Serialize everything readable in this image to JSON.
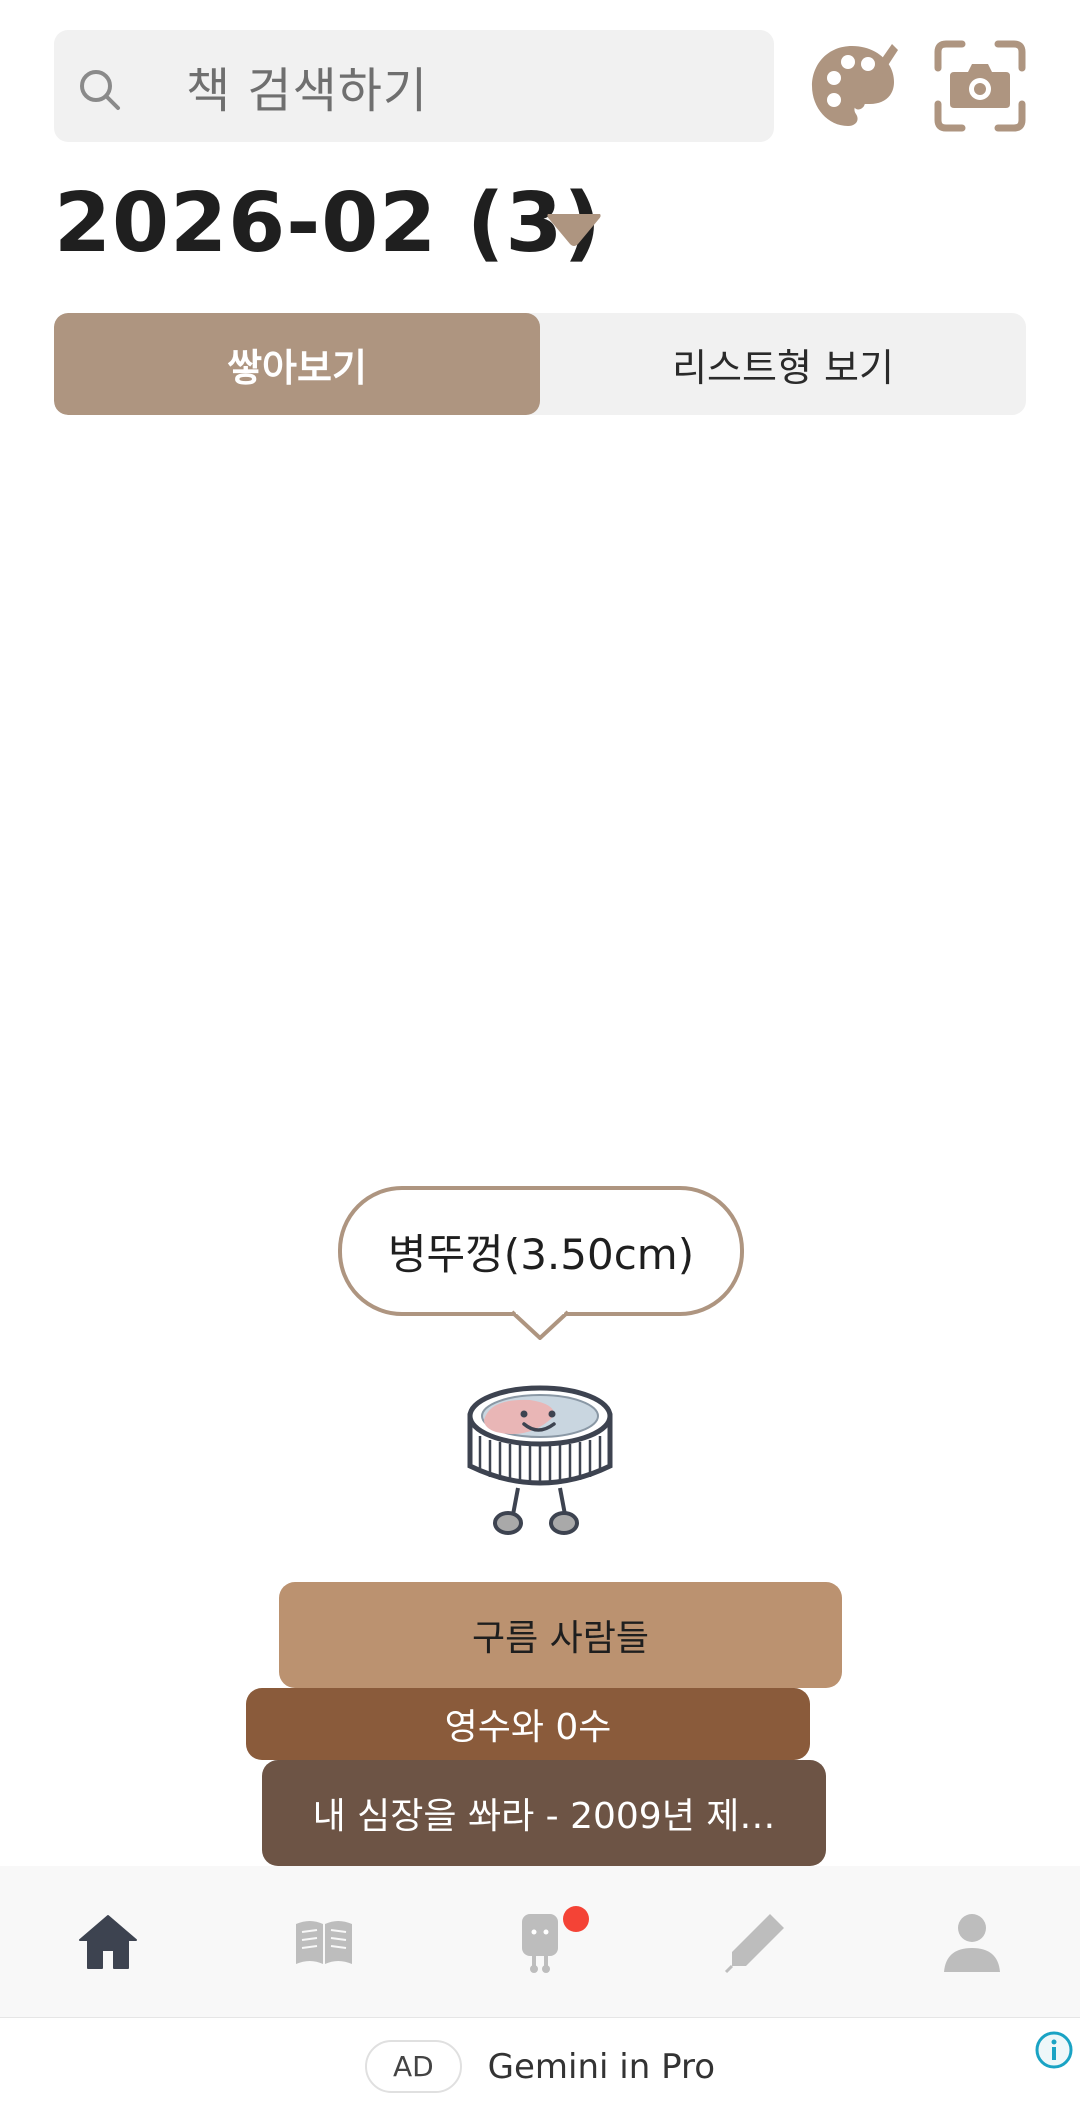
{
  "header": {
    "search_placeholder": "책 검색하기",
    "palette_icon": "palette-icon",
    "camera_icon": "camera-icon"
  },
  "month": {
    "title": "2026-02 (3)",
    "dropdown_icon": "caret-down-icon"
  },
  "view_toggle": {
    "tabs": [
      {
        "label": "쌓아보기",
        "active": true
      },
      {
        "label": "리스트형 보기",
        "active": false
      }
    ]
  },
  "bubble": {
    "text": "병뚜껑(3.50cm)"
  },
  "books": [
    {
      "title": "구름 사람들",
      "color": "#bb9270"
    },
    {
      "title": "영수와 0수",
      "color": "#8a5b3b"
    },
    {
      "title": "내 심장을 쏴라 - 2009년 제…",
      "color": "#6d5445"
    }
  ],
  "bottom_nav": {
    "items": [
      {
        "icon": "home-icon",
        "active": true
      },
      {
        "icon": "book-icon",
        "active": false
      },
      {
        "icon": "character-icon",
        "active": false,
        "notification": true
      },
      {
        "icon": "pencil-icon",
        "active": false
      },
      {
        "icon": "person-icon",
        "active": false
      }
    ]
  },
  "ad": {
    "badge": "AD",
    "text": "Gemini in Pro",
    "info_icon": "info-icon"
  },
  "colors": {
    "accent": "#ae9580",
    "nav_active": "#3d4350",
    "nav_inactive": "#bdbdbd",
    "notification": "#f44336"
  }
}
